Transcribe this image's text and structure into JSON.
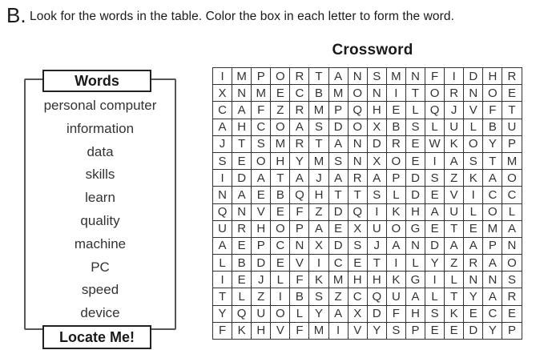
{
  "instruction": {
    "letter": "B.",
    "text": "Look for the words in the table. Color the box in each letter to form the word."
  },
  "words_panel": {
    "title": "Words",
    "items": [
      "personal computer",
      "information",
      "data",
      "skills",
      "learn",
      "quality",
      "machine",
      "PC",
      "speed",
      "device"
    ],
    "footer": "Locate Me!"
  },
  "crossword": {
    "title": "Crossword",
    "rows": [
      "IMPORTANSMNFIDHR",
      "XNMECBMONITORNOE",
      "CAFZRMPQHELQJVFT",
      "AHCOASDOXBSLULBU",
      "JTSMRTANDREWKOYP",
      "SEOHYMSNXOEIASTM",
      "IDATAJARAPDSZKAO",
      "NAEBQHTTSLDEVICC",
      "QNVEFZDQIKHAULOL",
      "URHOPAEXUOGETEMA",
      "AEPCNXDSJANDAAPN",
      "LBDEVICETILYZRAO",
      "IEJLFKMHHKGILNNS",
      "TLZIBSZCQUALTYAR",
      "YQUOLYAXDFHSKECE",
      "FKHVFMIVYSPEEDYP"
    ]
  }
}
